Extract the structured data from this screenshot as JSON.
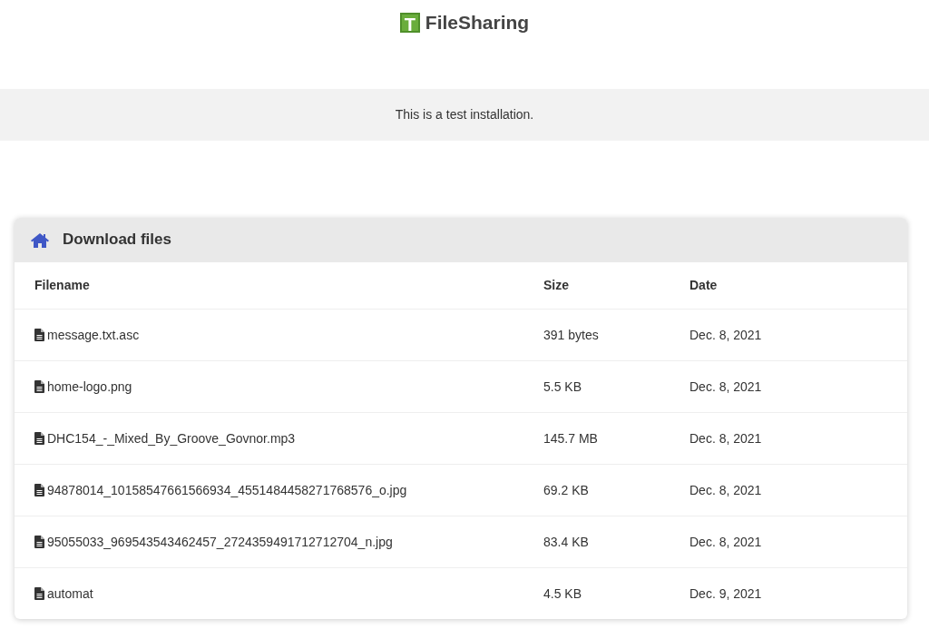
{
  "logo": {
    "letter": "T",
    "name": "FileSharing"
  },
  "notice": "This is a test installation.",
  "card": {
    "title": "Download files",
    "columns": [
      "Filename",
      "Size",
      "Date"
    ],
    "rows": [
      {
        "filename": "message.txt.asc",
        "size": "391 bytes",
        "date": "Dec. 8, 2021"
      },
      {
        "filename": "home-logo.png",
        "size": "5.5 KB",
        "date": "Dec. 8, 2021"
      },
      {
        "filename": "DHC154_-_Mixed_By_Groove_Govnor.mp3",
        "size": "145.7 MB",
        "date": "Dec. 8, 2021"
      },
      {
        "filename": "94878014_10158547661566934_4551484458271768576_o.jpg",
        "size": "69.2 KB",
        "date": "Dec. 8, 2021"
      },
      {
        "filename": "95055033_969543543462457_2724359491712712704_n.jpg",
        "size": "83.4 KB",
        "date": "Dec. 8, 2021"
      },
      {
        "filename": "automat",
        "size": "4.5 KB",
        "date": "Dec. 9, 2021"
      }
    ]
  }
}
